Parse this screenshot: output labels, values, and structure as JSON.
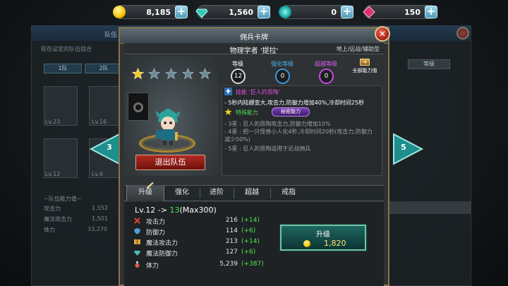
{
  "currency": [
    {
      "icon": "gold-coin-icon",
      "value": "8,185"
    },
    {
      "icon": "teal-gem-icon",
      "value": "1,560"
    },
    {
      "icon": "rune-orb-icon",
      "value": "0"
    },
    {
      "icon": "ruby-gem-icon",
      "value": "150"
    }
  ],
  "background": {
    "team_title": "队伍",
    "team_subtitle": "现在设定的队伍组合",
    "tab1": "1队",
    "tab2": "2队",
    "levels": [
      "Lv.23",
      "Lv.16",
      "Lv.12",
      "Lv.6"
    ],
    "grade_select": "等级",
    "team_power_title": "~队伍能力值~",
    "team_stats": [
      {
        "label": "攻击力",
        "value": "1,552"
      },
      {
        "label": "魔法攻击力",
        "value": "1,501"
      },
      {
        "label": "体力",
        "value": "33,270"
      }
    ],
    "left_arrow": "3",
    "right_arrow": "5"
  },
  "dialog": {
    "title": "佣兵卡牌",
    "hero_name": "物理学者 '提拉'",
    "hero_class": "地上/远战/辅助型",
    "close": "✕",
    "stars_filled": 1,
    "stars_total": 5,
    "level_label": "等级",
    "level_value": "12",
    "enhance_label": "强化等级",
    "enhance_value": "0",
    "transcend_label": "超越等级",
    "transcend_value": "0",
    "all_power_arrow": "➔",
    "all_power_label": "全部能力值",
    "skill_name": "技能 '巨人的思陶'",
    "skill_desc": "- 5秒内陆娜变大,攻击力,防御力增加40%,冷却时间25秒",
    "special_label": "特殊能力",
    "secret_label": "秘密能力",
    "special_lines": [
      "- 3星 : 巨人的思陶攻击力,防御力增加10%",
      "- 4星 : 把一只怪兽小人化4秒,冷却时间20秒(攻击力,防御力",
      "  减少50%)",
      "- 5星 : 巨人的思陶适用于近战佣兵"
    ],
    "leave_button": "退出队伍",
    "tabs": [
      "升级",
      "强化",
      "进阶",
      "超越",
      "戒指"
    ],
    "upgrade": {
      "from": "Lv.12 -> ",
      "to": "13",
      "max": "(Max300)",
      "stats": [
        {
          "name": "攻击力",
          "value": "216",
          "delta": "(+14)",
          "icon_color": "#e0453a"
        },
        {
          "name": "防御力",
          "value": "114",
          "delta": "(+6)",
          "icon_color": "#4aa3d6"
        },
        {
          "name": "魔法攻击力",
          "value": "213",
          "delta": "(+14)",
          "icon_color": "#e0a53a"
        },
        {
          "name": "魔法防御力",
          "value": "127",
          "delta": "(+6)",
          "icon_color": "#47c3b5"
        },
        {
          "name": "体力",
          "value": "5,239",
          "delta": "(+387)",
          "icon_color": "#e05a4a"
        }
      ],
      "button_label": "升级",
      "cost": "1,820"
    }
  }
}
